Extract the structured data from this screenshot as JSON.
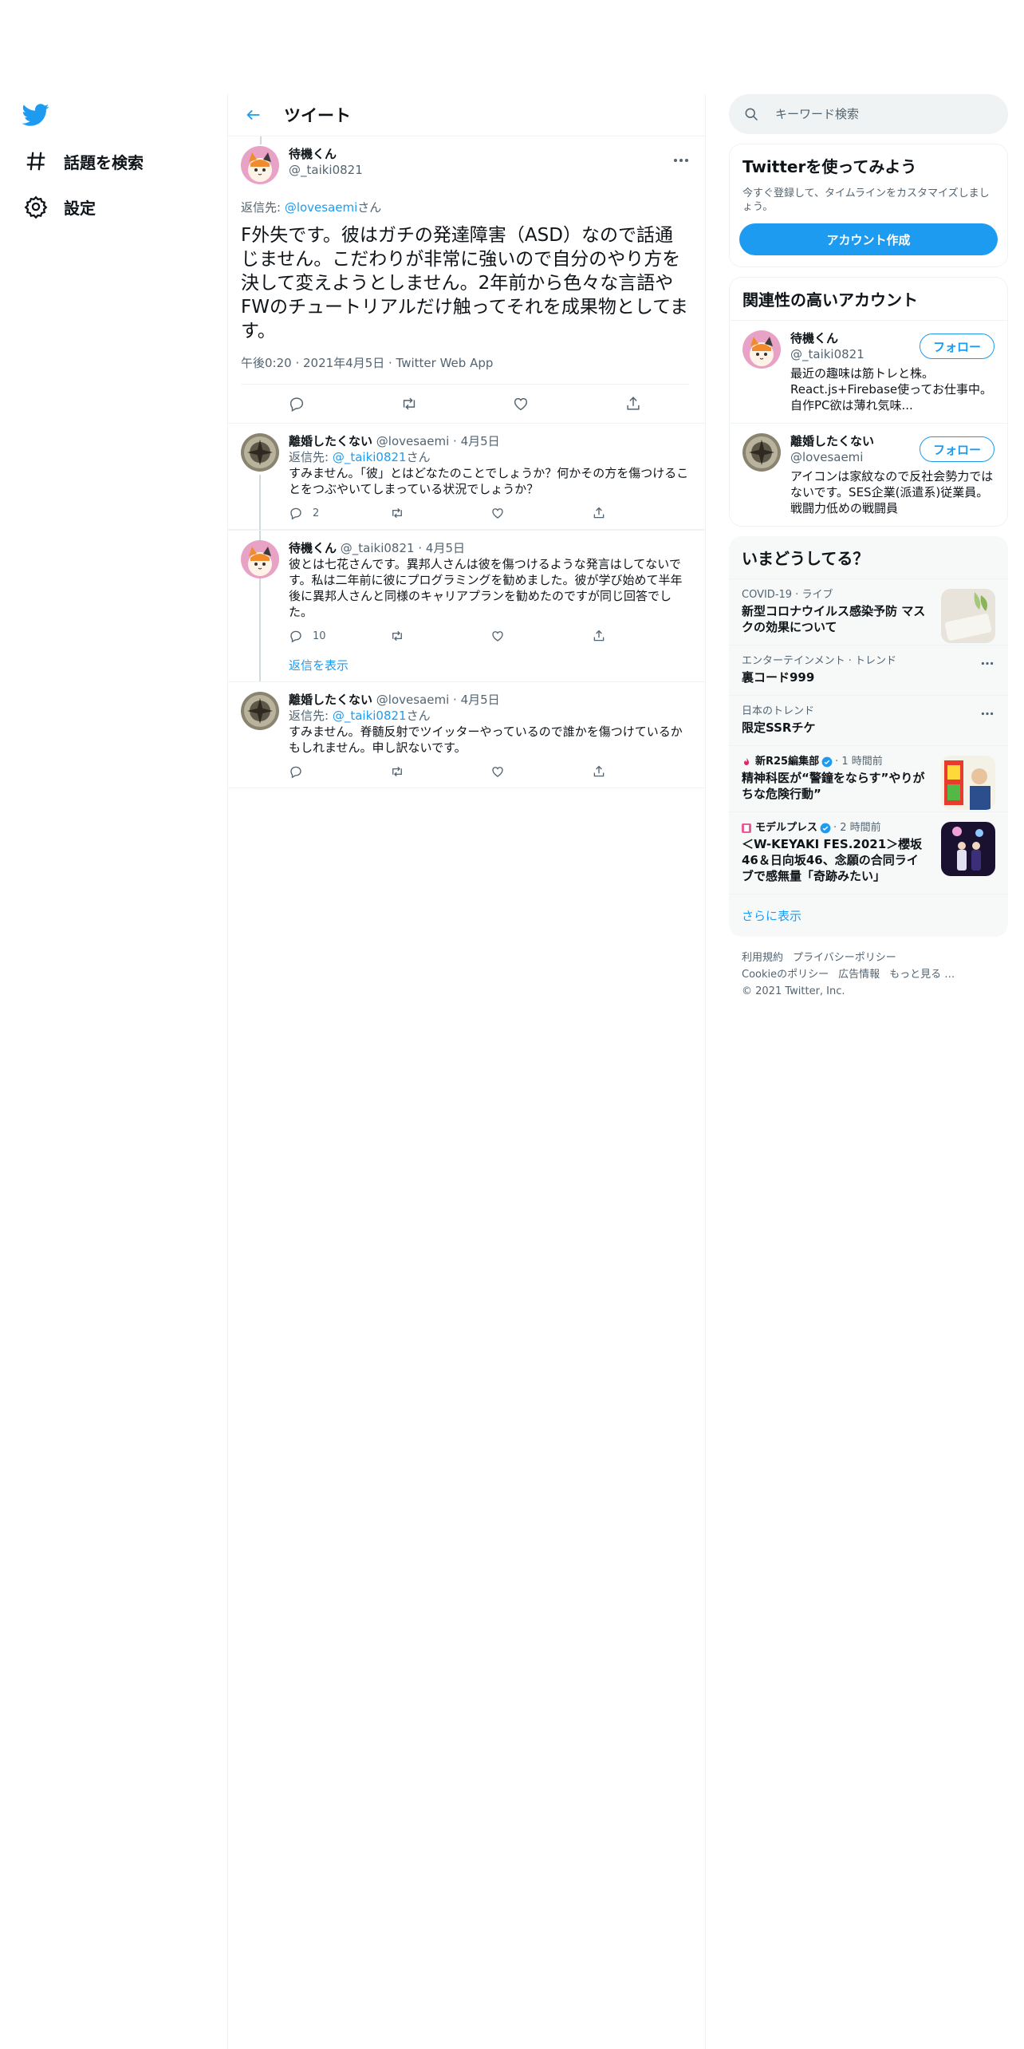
{
  "nav": {
    "items": [
      {
        "label": "話題を検索",
        "icon": "hashtag-icon"
      },
      {
        "label": "設定",
        "icon": "gear-icon"
      }
    ]
  },
  "main": {
    "title": "ツイート",
    "focused": {
      "name": "待機くん",
      "handle": "@_taiki0821",
      "reply_prefix": "返信先: ",
      "reply_to": "@lovesaemi",
      "reply_suffix": "さん",
      "text": "F外失です。彼はガチの発達障害（ASD）なので話通じません。こだわりが非常に強いので自分のやり方を決して変えようとしません。2年前から色々な言語やFWのチュートリアルだけ触ってそれを成果物としてます。",
      "meta": "午後0:20 · 2021年4月5日 · Twitter Web App"
    },
    "replies": [
      {
        "name": "離婚したくない",
        "handle": "@lovesaemi",
        "date": "· 4月5日",
        "reply_prefix": "返信先: ",
        "reply_to": "@_taiki0821",
        "reply_suffix": "さん",
        "text": "すみません。「彼」とはどなたのことでしょうか？何かその方を傷つけることをつぶやいてしまっている状況でしょうか？",
        "reply_count": "2",
        "retweet_count": "",
        "like_count": ""
      },
      {
        "name": "待機くん",
        "handle": "@_taiki0821",
        "date": "· 4月5日",
        "text": "彼とは七花さんです。異邦人さんは彼を傷つけるような発言はしてないです。私は二年前に彼にプログラミングを勧めました。彼が学び始めて半年後に異邦人さんと同様のキャリアプランを勧めたのですが同じ回答でした。",
        "reply_count": "10",
        "retweet_count": "",
        "like_count": ""
      },
      {
        "name": "離婚したくない",
        "handle": "@lovesaemi",
        "date": "· 4月5日",
        "reply_prefix": "返信先: ",
        "reply_to": "@_taiki0821",
        "reply_suffix": "さん",
        "text": "すみません。脊髄反射でツイッターやっているので誰かを傷つけているかもしれません。申し訳ないです。",
        "reply_count": "",
        "retweet_count": "",
        "like_count": ""
      }
    ],
    "show_replies": "返信を表示"
  },
  "right": {
    "search_placeholder": "キーワード検索",
    "join": {
      "title": "Twitterを使ってみよう",
      "subtitle": "今すぐ登録して、タイムラインをカスタマイズしましょう。",
      "button": "アカウント作成"
    },
    "relevant": {
      "title": "関連性の高いアカウント",
      "accounts": [
        {
          "name": "待機くん",
          "handle": "@_taiki0821",
          "bio": "最近の趣味は筋トレと株。React.js+Firebase使ってお仕事中。自作PC欲は薄れ気味...",
          "follow": "フォロー"
        },
        {
          "name": "離婚したくない",
          "handle": "@lovesaemi",
          "bio": "アイコンは家紋なので反社会勢力ではないです。SES企業(派遣系)従業員。戦闘力低めの戦闘員",
          "follow": "フォロー"
        }
      ]
    },
    "trends": {
      "title": "いまどうしてる？",
      "items": [
        {
          "meta": "COVID-19 · ライブ",
          "title": "新型コロナウイルス感染予防 マスクの効果について"
        },
        {
          "meta": "エンターテインメント · トレンド",
          "title": "裏コード999"
        },
        {
          "meta": "日本のトレンド",
          "title": "限定SSRチケ"
        },
        {
          "source": "新R25編集部",
          "time": "· 1 時間前",
          "title": "精神科医が“警鐘をならす”やりがちな危険行動”"
        },
        {
          "source": "モデルプレス",
          "time": "· 2 時間前",
          "title": "＜W-KEYAKI FES.2021＞櫻坂46＆日向坂46、念願の合同ライブで感無量「奇跡みたい」"
        }
      ],
      "show_more": "さらに表示"
    },
    "footer": {
      "links": [
        "利用規約",
        "プライバシーポリシー",
        "Cookieのポリシー",
        "広告情報",
        "もっと見る …"
      ],
      "copyright": "© 2021 Twitter, Inc."
    }
  },
  "colors": {
    "accent": "#1d9bf0",
    "text": "#0f1419",
    "secondary": "#536471",
    "border": "#eff3f4"
  }
}
